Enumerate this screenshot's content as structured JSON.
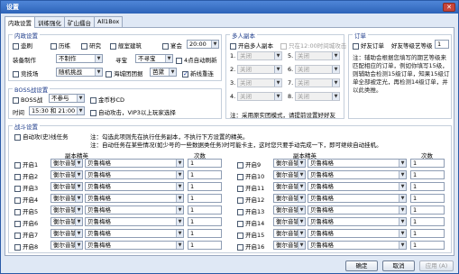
{
  "window": {
    "title": "设置",
    "close": "✕"
  },
  "tabs": [
    "内政设置",
    "训练强化",
    "矿山擂台",
    "All1Box"
  ],
  "neizheng": {
    "title": "内政设置",
    "row1": {
      "zhuangbei": "壶刷",
      "mansu": "历练",
      "yanjiu": "研究",
      "zhanjiao": "舰室建筑",
      "yanhui": "宴会",
      "yanhui_time": "20:00"
    },
    "row2": {
      "label": "装备制作",
      "value": "不制作",
      "xunbao_label": "寻宝",
      "xunbao_value": "不寻宝",
      "auto_refresh": "4点自动刷新"
    },
    "row3": {
      "label": "竞技场",
      "value": "随机挑战",
      "haizhan_label": "海城团团据",
      "haizhan_value": "芭黛",
      "chongxin": "新线重连"
    }
  },
  "boss": {
    "title": "BOSS战设置",
    "row1": {
      "label": "BOSS战",
      "value": "不参与",
      "jinbi": "金币秒CD"
    },
    "row2": {
      "time_label": "时间",
      "time_value": "15:30 和 21:00",
      "auto_attack": "自动攻击，VIP3以上玩家选择"
    }
  },
  "duoren": {
    "title": "多人副本",
    "open": "开启多人副本",
    "open_note": "只在12:00时间城攻击",
    "slots": [
      {
        "n": "1.",
        "v": "关闭"
      },
      {
        "n": "5.",
        "v": "关闭"
      },
      {
        "n": "2.",
        "v": "关闭"
      },
      {
        "n": "6.",
        "v": "关闭"
      },
      {
        "n": "3.",
        "v": "关闭"
      },
      {
        "n": "7.",
        "v": "关闭"
      },
      {
        "n": "4.",
        "v": "关闭"
      },
      {
        "n": "8.",
        "v": "关闭"
      }
    ],
    "note": "注：采用原实团模式，请提前设置好好友"
  },
  "dingdan": {
    "title": "订单",
    "haoyou": "好友订单",
    "level_label": "好友等级艺等级",
    "level_value": "1",
    "note": "注：辅助会根据您填写的期艺等级来匹配相应的订单，例如你填写15级，则辅助会检测15级订单，知果15级订单全部被定光，再检测14级订单，并以此类推。"
  },
  "zhanji": {
    "title": "战斗设置",
    "auto_attack": "自动攻(史)线任务",
    "note1": "注：勾选此项则先在执行任务副本，不执行下方设置的精英。",
    "note2": "注：自动任务在某些情况(如少号的一些数据类任务)时可能卡主，这时您只要手动完成一下，即可继续自动挂机。",
    "col_fuben": "副本精英",
    "col_cishu": "次数",
    "rows_left": [
      {
        "label": "开启1",
        "fuben": "衡尔音镇",
        "elite": "贝鲁梅格",
        "count": "1"
      },
      {
        "label": "开启2",
        "fuben": "衡尔音镇",
        "elite": "贝鲁梅格",
        "count": "1"
      },
      {
        "label": "开启3",
        "fuben": "衡尔音镇",
        "elite": "贝鲁梅格",
        "count": "1"
      },
      {
        "label": "开启4",
        "fuben": "衡尔音镇",
        "elite": "贝鲁梅格",
        "count": "1"
      },
      {
        "label": "开启5",
        "fuben": "衡尔音镇",
        "elite": "贝鲁梅格",
        "count": "1"
      },
      {
        "label": "开启6",
        "fuben": "衡尔音镇",
        "elite": "贝鲁梅格",
        "count": "1"
      },
      {
        "label": "开启7",
        "fuben": "衡尔音镇",
        "elite": "贝鲁梅格",
        "count": "1"
      },
      {
        "label": "开启8",
        "fuben": "衡尔音镇",
        "elite": "贝鲁梅格",
        "count": "1"
      }
    ],
    "rows_right": [
      {
        "label": "开启9",
        "fuben": "衡尔音镇",
        "elite": "贝鲁梅格",
        "count": "1"
      },
      {
        "label": "开启10",
        "fuben": "衡尔音镇",
        "elite": "贝鲁梅格",
        "count": "1"
      },
      {
        "label": "开启11",
        "fuben": "衡尔音镇",
        "elite": "贝鲁梅格",
        "count": "1"
      },
      {
        "label": "开启12",
        "fuben": "衡尔音镇",
        "elite": "贝鲁梅格",
        "count": "1"
      },
      {
        "label": "开启13",
        "fuben": "衡尔音镇",
        "elite": "贝鲁梅格",
        "count": "1"
      },
      {
        "label": "开启14",
        "fuben": "衡尔音镇",
        "elite": "贝鲁梅格",
        "count": "1"
      },
      {
        "label": "开启15",
        "fuben": "衡尔音镇",
        "elite": "贝鲁梅格",
        "count": "1"
      },
      {
        "label": "开启16",
        "fuben": "衡尔音镇",
        "elite": "贝鲁梅格",
        "count": "1"
      }
    ]
  },
  "buttons": {
    "ok": "确定",
    "cancel": "取消",
    "apply": "应用 (A)"
  },
  "icons": {
    "dropdown": "▼",
    "spin_up": "▲",
    "spin_down": "▼"
  }
}
